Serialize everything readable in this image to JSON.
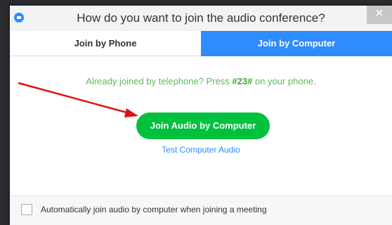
{
  "window": {
    "title": "How do you want to join the audio conference?",
    "close_glyph": "✕"
  },
  "tabs": [
    {
      "label": "Join by Phone",
      "active": false
    },
    {
      "label": "Join by Computer",
      "active": true
    }
  ],
  "main": {
    "hint_prefix": "Already joined by telephone? Press ",
    "hint_code": "#23#",
    "hint_suffix": " on your phone.",
    "join_button_label": "Join Audio by Computer",
    "test_link_label": "Test Computer Audio"
  },
  "footer": {
    "auto_join_label": "Automatically join audio by computer when joining a meeting",
    "auto_join_checked": false
  },
  "colors": {
    "accent_blue": "#2d8cff",
    "join_green": "#00c13d",
    "hint_green": "#5cb85c",
    "annotation_arrow": "#e01010"
  },
  "icons": {
    "app": "zoom-camera-icon",
    "close": "close-icon",
    "annotation": "red-arrow-annotation"
  }
}
